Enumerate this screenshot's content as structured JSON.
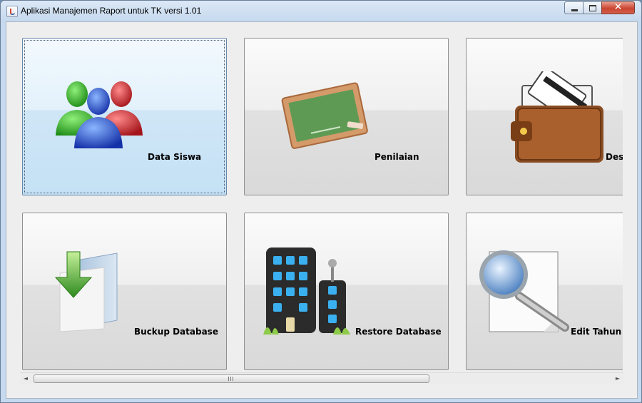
{
  "window": {
    "title": "Aplikasi Manajemen Raport untuk TK versi 1.01",
    "controls": {
      "minimize": "minimize",
      "maximize": "maximize",
      "close": "✕"
    }
  },
  "menu": {
    "tiles": [
      {
        "label": "Data Siswa",
        "icon": "users-icon",
        "selected": true
      },
      {
        "label": "Penilaian",
        "icon": "chalkboard-icon",
        "selected": false
      },
      {
        "label": "Des",
        "icon": "wallet-icon",
        "selected": false
      },
      {
        "label": "Buckup Database",
        "icon": "folder-download-icon",
        "selected": false
      },
      {
        "label": "Restore Database",
        "icon": "building-icon",
        "selected": false
      },
      {
        "label": "Edit Tahun F",
        "icon": "document-search-icon",
        "selected": false
      }
    ]
  },
  "scrollbar": {
    "left_arrow": "◄",
    "right_arrow": "►"
  }
}
